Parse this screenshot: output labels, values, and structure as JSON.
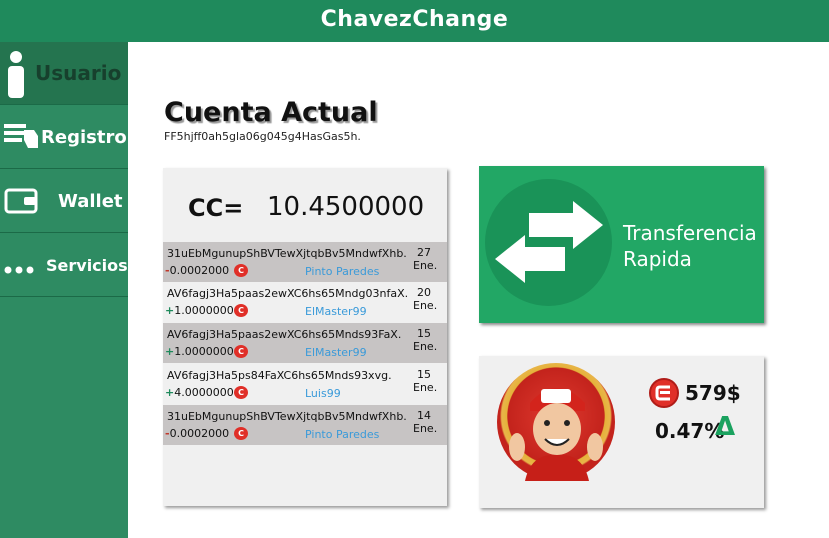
{
  "app": {
    "title": "ChavezChange"
  },
  "sidebar": {
    "items": [
      {
        "label": "Usuario",
        "icon": "user-icon",
        "active": true
      },
      {
        "label": "Registro",
        "icon": "hand-card-icon",
        "active": false
      },
      {
        "label": "Wallet",
        "icon": "wallet-icon",
        "active": false
      },
      {
        "label": "Servicios",
        "icon": "dots-icon",
        "active": false
      }
    ]
  },
  "account": {
    "title": "Cuenta Actual",
    "id": "FF5hjff0ah5gla06g045g4HasGas5h."
  },
  "wallet": {
    "balance_label": "CC=",
    "balance_value": "10.4500000",
    "transactions": [
      {
        "hash": "31uEbMgunupShBVTewXjtqbBv5MndwfXhb.",
        "sign": "-",
        "amount": "0.0002000",
        "user": "Pinto Paredes",
        "date_day": "27",
        "date_month": "Ene."
      },
      {
        "hash": "AV6fagj3Ha5paas2ewXC6hs65Mndg03nfaX.",
        "sign": "+",
        "amount": "1.0000000",
        "user": "ElMaster99",
        "date_day": "20",
        "date_month": "Ene."
      },
      {
        "hash": "AV6fagj3Ha5paas2ewXC6hs65Mnds93FaX.",
        "sign": "+",
        "amount": "1.0000000",
        "user": "ElMaster99",
        "date_day": "15",
        "date_month": "Ene."
      },
      {
        "hash": "AV6fagj3Ha5ps84FaXC6hs65Mnds93xvg.",
        "sign": "+",
        "amount": "4.0000000",
        "user": "Luis99",
        "date_day": "15",
        "date_month": "Ene."
      },
      {
        "hash": "31uEbMgunupShBVTewXjtqbBv5MndwfXhb.",
        "sign": "-",
        "amount": "0.0002000",
        "user": "Pinto Paredes",
        "date_day": "14",
        "date_month": "Ene."
      }
    ]
  },
  "transfer": {
    "line1": "Transferencia",
    "line2": "Rapida"
  },
  "stats": {
    "price": "579$",
    "change": "0.47%",
    "delta_symbol": "Δ"
  },
  "colors": {
    "brand_green": "#1f8a5c",
    "sidebar_green": "#2e8b62",
    "transfer_green": "#22a765",
    "coin_red": "#e02f28",
    "link_blue": "#3a9ad9"
  }
}
